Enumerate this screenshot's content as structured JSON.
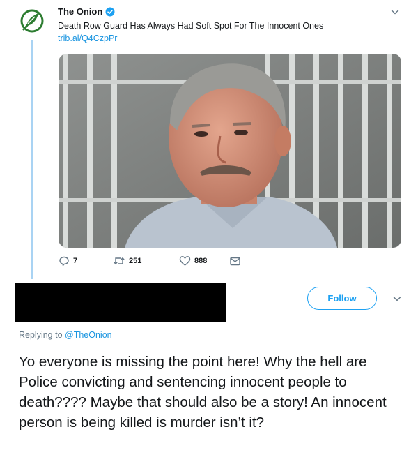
{
  "top_tweet": {
    "author_name": "The Onion",
    "text": "Death Row Guard Has Always Had Soft Spot For The Innocent Ones",
    "link": "trib.al/Q4CzpPr",
    "actions": {
      "reply_count": "7",
      "retweet_count": "251",
      "like_count": "888"
    }
  },
  "reply_tweet": {
    "follow_label": "Follow",
    "replying_prefix": "Replying to",
    "replying_handle": "@TheOnion",
    "text": "Yo everyone is missing the point here! Why the hell are Police convicting and sentencing innocent people to death???? Maybe that should also be a story! An innocent person is being killed is murder isn’t it?"
  },
  "colors": {
    "accent": "#1da1f2",
    "link": "#1b95e0",
    "muted": "#657786",
    "onion_green": "#2e7d32",
    "thread_line": "#a9d3f3"
  },
  "icons": {
    "avatar": "onion-logo",
    "verified": "verified-badge-icon",
    "menu": "chevron-down-icon",
    "reply": "reply-icon",
    "retweet": "retweet-icon",
    "like": "heart-icon",
    "message": "direct-message-icon"
  }
}
